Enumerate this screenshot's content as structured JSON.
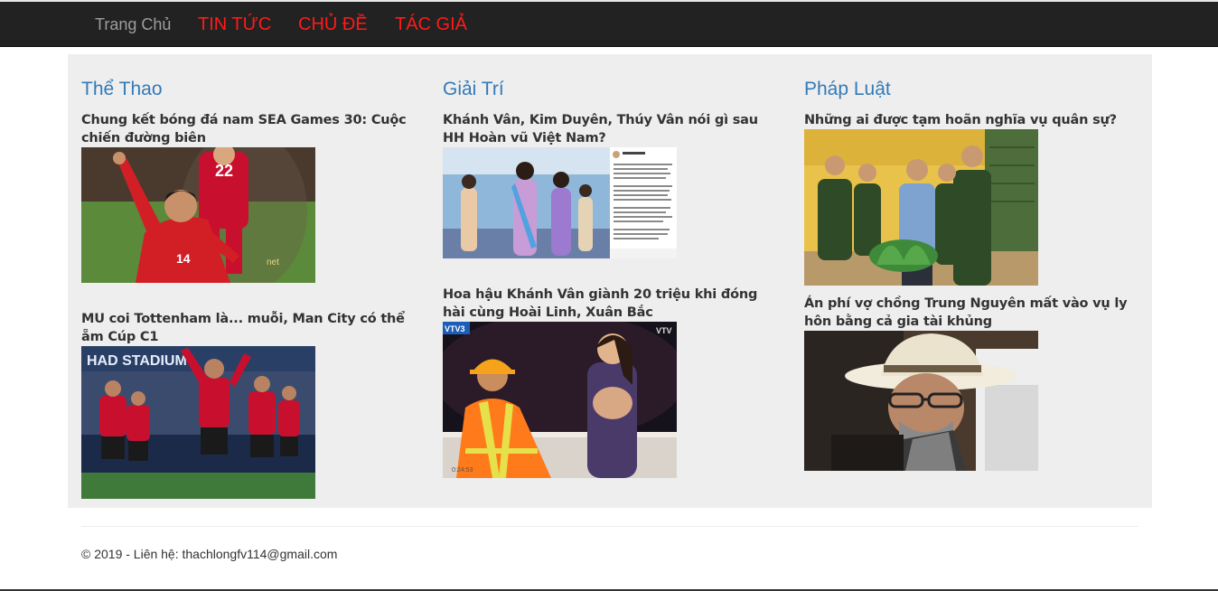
{
  "nav": {
    "home": "Trang Chủ",
    "news": "TIN TỨC",
    "topics": "CHỦ ĐỀ",
    "authors": "TÁC GIẢ"
  },
  "columns": [
    {
      "category": "Thể Thao",
      "articles": [
        {
          "title": "Chung kết bóng đá nam SEA Games 30: Cuộc chiến đường biên",
          "image": "soccer-player-celebrating-photo"
        },
        {
          "title": "MU coi Tottenham là... muỗi, Man City có thể ẵm Cúp C1",
          "image": "manchester-united-players-photo"
        }
      ]
    },
    {
      "category": "Giải Trí",
      "articles": [
        {
          "title": "Khánh Vân, Kim Duyên, Thúy Vân nói gì sau HH Hoàn vũ Việt Nam?",
          "image": "beauty-pageant-photo"
        },
        {
          "title": "Hoa hậu Khánh Vân giành 20 triệu khi đóng hài cùng Hoài Linh, Xuân Bắc",
          "image": "tv-comedy-show-photo"
        }
      ]
    },
    {
      "category": "Pháp Luật",
      "articles": [
        {
          "title": "Những ai được tạm hoãn nghĩa vụ quân sự?",
          "image": "military-officers-photo"
        },
        {
          "title": "Án phí vợ chồng Trung Nguyên mất vào vụ ly hôn bằng cả gia tài khủng",
          "image": "man-with-hat-photo"
        }
      ]
    }
  ],
  "footer": {
    "text": "© 2019 - Liên hệ: thachlongfv114@gmail.com"
  },
  "colors": {
    "navbar_bg": "#222222",
    "nav_accent": "#ff1a1a",
    "category_blue": "#337ab7",
    "content_bg": "#eeeeee"
  }
}
